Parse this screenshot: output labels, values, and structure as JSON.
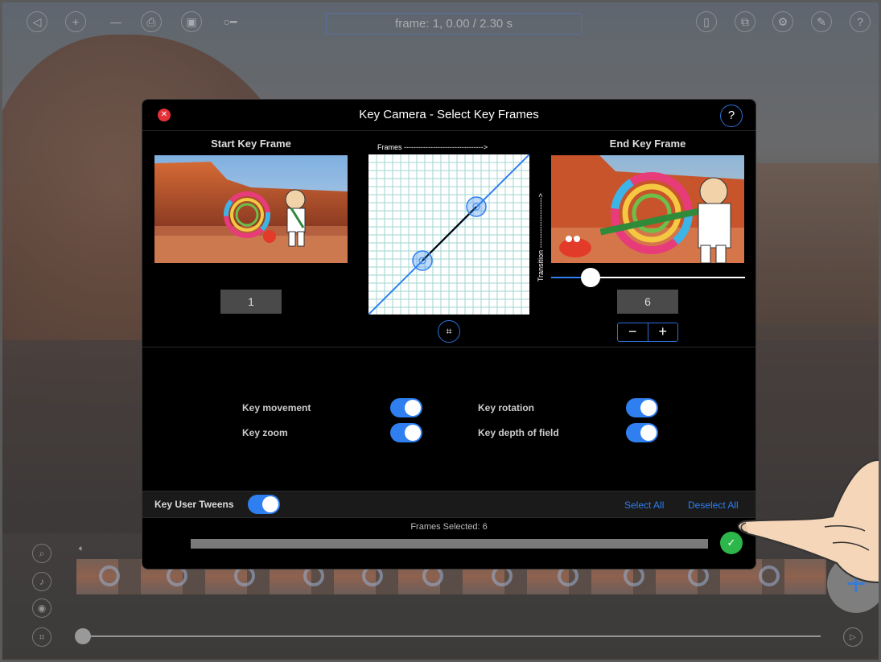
{
  "toolbar": {
    "frame_display": "frame: 1, 0.00 / 2.30 s",
    "left_icons": [
      "back-icon",
      "plus-icon",
      "minus-icon",
      "stamp-icon",
      "photo-icon",
      "key-icon"
    ],
    "right_icons": [
      "clipboard-icon",
      "share-icon",
      "gear-icon",
      "wrench-icon",
      "help-icon"
    ]
  },
  "dialog": {
    "title": "Key Camera - Select Key Frames",
    "help_label": "?",
    "start": {
      "label": "Start Key Frame",
      "frame": "1"
    },
    "end": {
      "label": "End Key Frame",
      "frame": "6",
      "slider_level": 0.2
    },
    "graph": {
      "x_label": "Frames --------------------------------->",
      "y_label": "Transition --------------------->"
    },
    "stepper": {
      "minus": "−",
      "plus": "+"
    },
    "options": {
      "key_movement": {
        "label": "Key movement",
        "on": true
      },
      "key_zoom": {
        "label": "Key zoom",
        "on": true
      },
      "key_rotation": {
        "label": "Key rotation",
        "on": true
      },
      "key_depth_of_field": {
        "label": "Key depth of field",
        "on": true
      }
    },
    "tweens": {
      "label": "Key User Tweens",
      "on": true,
      "select_all": "Select All",
      "deselect_all": "Deselect All"
    },
    "frames_selected": "Frames Selected: 6",
    "confirm_icon": "checkmark-icon"
  },
  "timeline": {
    "side_icons": [
      "magnify-icon",
      "mic-icon",
      "compass-icon",
      "center-icon"
    ],
    "sound_icon": "speaker-icon",
    "add_label": "+",
    "play_icon": "play-icon"
  },
  "colors": {
    "accent": "#2f7ff0",
    "close": "#e5303a",
    "confirm": "#2db74a",
    "dialog_bg": "#000000"
  }
}
